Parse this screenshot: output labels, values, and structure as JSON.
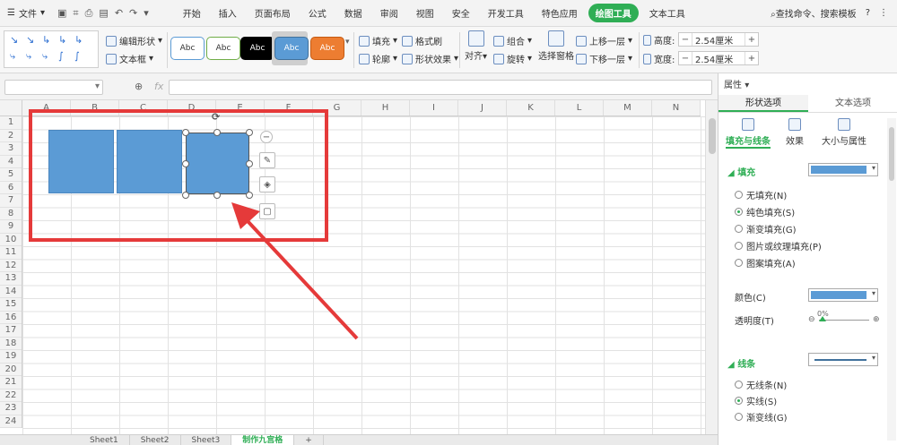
{
  "menubar": {
    "file_label": "文件",
    "tabs": [
      "开始",
      "插入",
      "页面布局",
      "公式",
      "数据",
      "审阅",
      "视图",
      "安全",
      "开发工具",
      "特色应用",
      "绘图工具",
      "文本工具"
    ],
    "active_tab": "绘图工具",
    "search_label": "查找命令、搜索模板",
    "help": "?"
  },
  "ribbon": {
    "edit_shape": "编辑形状",
    "text_box": "文本框",
    "styles": [
      {
        "label": "Abc",
        "bg": "#ffffff",
        "fg": "#333333",
        "border": "#5b9bd5"
      },
      {
        "label": "Abc",
        "bg": "#ffffff",
        "fg": "#333333",
        "border": "#70ad47"
      },
      {
        "label": "Abc",
        "bg": "#000000",
        "fg": "#ffffff",
        "border": "#000000"
      },
      {
        "label": "Abc",
        "bg": "#5b9bd5",
        "fg": "#ffffff",
        "border": "#41719c"
      },
      {
        "label": "Abc",
        "bg": "#ed7d31",
        "fg": "#ffffff",
        "border": "#c55a11"
      }
    ],
    "fill": "填充",
    "format_painter": "格式刷",
    "outline": "轮廓",
    "shape_effects": "形状效果",
    "align": "对齐",
    "group": "组合",
    "rotate": "旋转",
    "selection_pane": "选择窗格",
    "bring_forward": "上移一层",
    "send_backward": "下移一层",
    "height_label": "高度:",
    "height_value": "2.54厘米",
    "width_label": "宽度:",
    "width_value": "2.54厘米"
  },
  "formula": {
    "fx": "fx"
  },
  "grid": {
    "columns": [
      "A",
      "B",
      "C",
      "D",
      "E",
      "F",
      "G",
      "H",
      "I",
      "J",
      "K",
      "L",
      "M",
      "N"
    ],
    "rows": [
      "1",
      "2",
      "3",
      "4",
      "5",
      "6",
      "7",
      "8",
      "9",
      "10",
      "11",
      "12",
      "13",
      "14",
      "15",
      "16",
      "17",
      "18",
      "19",
      "20",
      "21",
      "22",
      "23",
      "24"
    ]
  },
  "sheets": [
    "Sheet1",
    "Sheet2",
    "Sheet3",
    "制作九宫格"
  ],
  "active_sheet": "制作九宫格",
  "pane": {
    "title": "属性",
    "tabs": [
      "形状选项",
      "文本选项"
    ],
    "subtabs": [
      "填充与线条",
      "效果",
      "大小与属性"
    ],
    "fill_section": "填充",
    "fill_options": [
      "无填充(N)",
      "纯色填充(S)",
      "渐变填充(G)",
      "图片或纹理填充(P)",
      "图案填充(A)"
    ],
    "selected_fill": "纯色填充(S)",
    "color_label": "颜色(C)",
    "transparency_label": "透明度(T)",
    "transparency_value": "0%",
    "line_section": "线条",
    "line_options": [
      "无线条(N)",
      "实线(S)",
      "渐变线(G)"
    ],
    "shape_color": "#5b9bd5"
  }
}
